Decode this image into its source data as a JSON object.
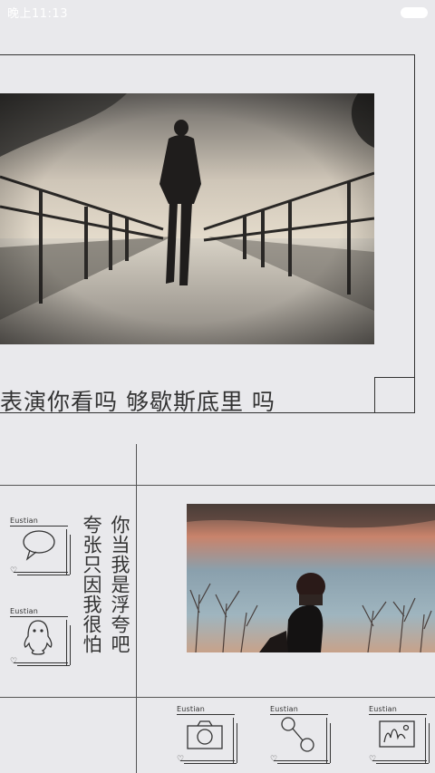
{
  "status_bar": {
    "time": "晚上11:13",
    "battery_icon": "battery-icon"
  },
  "featured": {
    "caption": "表演你看吗 够歇斯底里 吗",
    "photo_icon": "photo-man-walking-snowy-bridge"
  },
  "poem": {
    "line1": "你当我是浮夸吧",
    "line2": "夸张只因我很怕"
  },
  "second_photo": {
    "photo_icon": "photo-person-sunset-sky"
  },
  "cards": [
    {
      "tag": "Eustian",
      "icon": "chat-bubble-icon"
    },
    {
      "tag": "Eustian",
      "icon": "qq-penguin-icon"
    },
    {
      "tag": "Eustian",
      "icon": "camera-icon"
    },
    {
      "tag": "Eustian",
      "icon": "route-icon"
    },
    {
      "tag": "Eustian",
      "icon": "gallery-icon"
    }
  ],
  "colors": {
    "background": "#e9e9ec",
    "line": "#333333"
  }
}
